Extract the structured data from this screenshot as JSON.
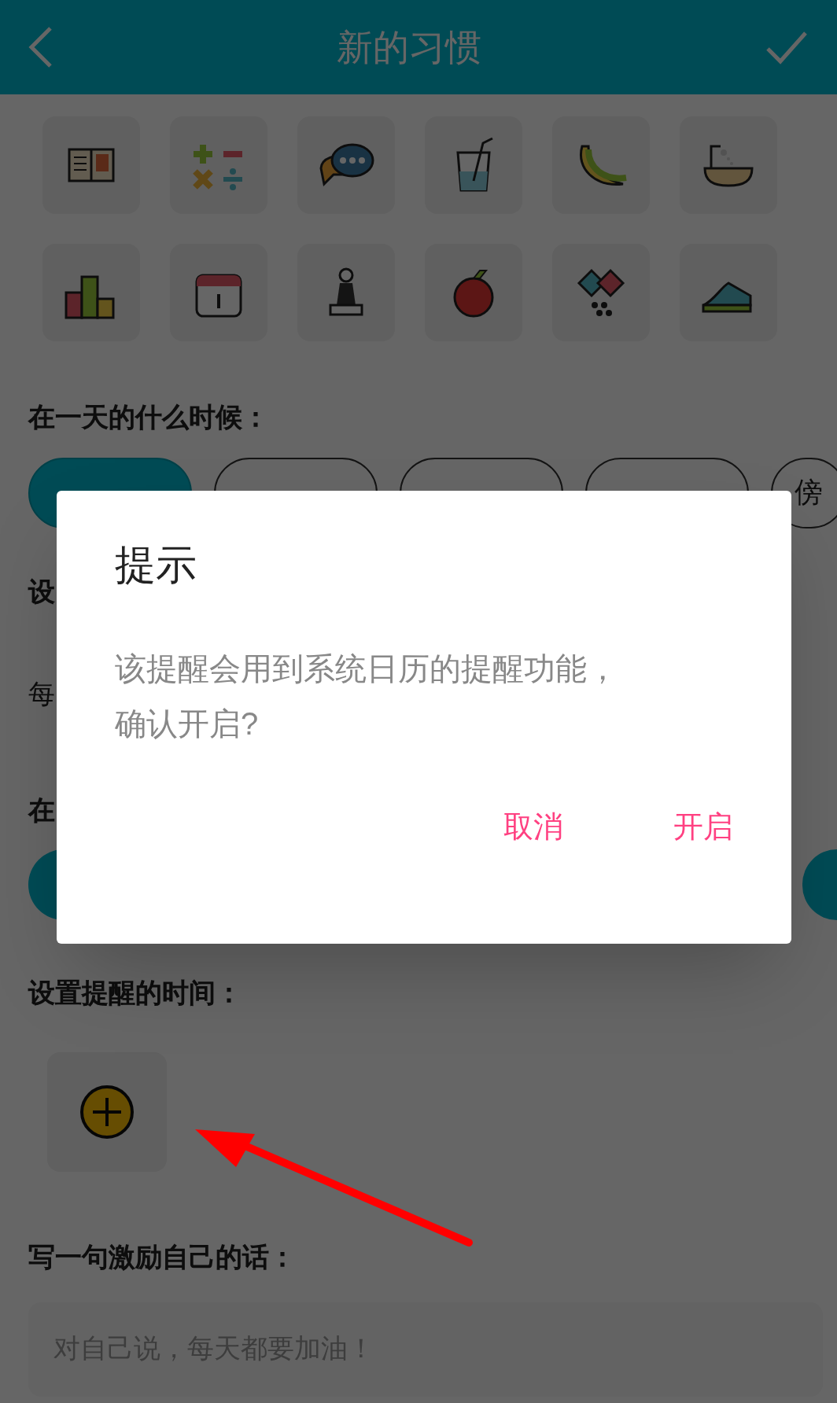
{
  "header": {
    "title": "新的习惯"
  },
  "time_section": {
    "label": "在一天的什么时候：",
    "chips": [
      {
        "selected": true
      },
      {
        "selected": false
      },
      {
        "selected": false
      },
      {
        "selected": false
      },
      {
        "label": "傍",
        "selected": false
      }
    ]
  },
  "hidden_labels": [
    "设",
    "每",
    "在"
  ],
  "second_chips": [
    {
      "selected": true
    },
    {
      "selected": true
    }
  ],
  "reminder_section": {
    "label": "设置提醒的时间："
  },
  "motto_section": {
    "label": "写一句激励自己的话：",
    "placeholder": "对自己说，每天都要加油！"
  },
  "dialog": {
    "title": "提示",
    "message": "该提醒会用到系统日历的提醒功能，确认开启?",
    "buttons": [
      "取消",
      "开启"
    ]
  }
}
